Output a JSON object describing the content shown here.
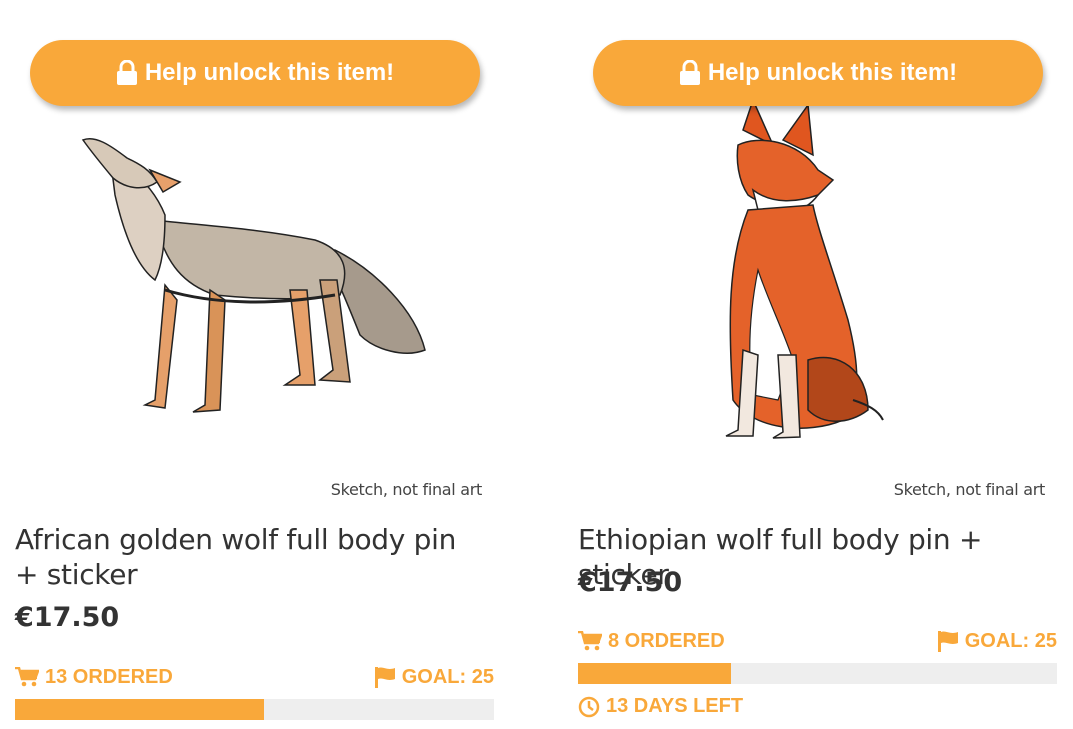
{
  "products": [
    {
      "unlock_label": "Help unlock this item!",
      "sketch_note": "Sketch, not final art",
      "title": "African golden wolf full body pin + sticker",
      "price": "€17.50",
      "ordered_text": "13 ORDERED",
      "goal_text": "GOAL: 25",
      "progress": 0.52
    },
    {
      "unlock_label": "Help unlock this item!",
      "sketch_note": "Sketch, not final art",
      "title": "Ethiopian wolf full body pin + sticker",
      "price": "€17.50",
      "ordered_text": "8 ORDERED",
      "goal_text": "GOAL: 25",
      "progress": 0.32,
      "days_left_text": "13 DAYS LEFT"
    }
  ],
  "colors": {
    "accent": "#f9a83a",
    "track": "#eeeeee",
    "text": "#333333"
  },
  "icons": [
    "lock-icon",
    "cart-icon",
    "flag-icon",
    "clock-icon"
  ]
}
